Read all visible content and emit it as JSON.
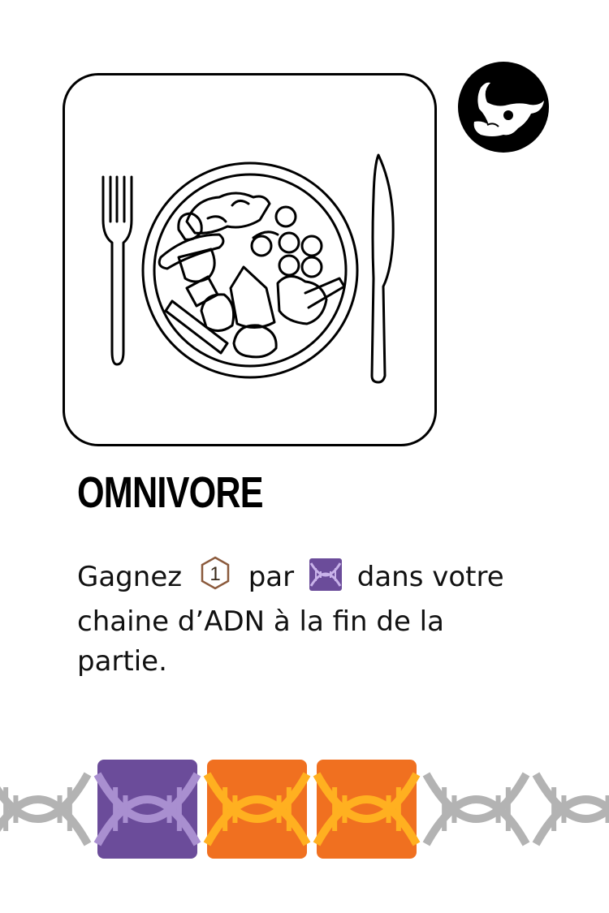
{
  "card": {
    "title": "OMNIVORE",
    "description": {
      "part1": "Gagnez",
      "part2": "par",
      "part3": "dans votre",
      "line2": "chaine d’ADN à la fin de la",
      "line3": "partie."
    },
    "reward_value": "1",
    "reward_icon": "hexagon-point-icon",
    "dna_icon": "purple-dna-icon",
    "badge_icon": "bull-skull-icon",
    "illustration": "plate-fork-knife-icon"
  },
  "dna_chain": [
    {
      "kind": "gray",
      "color": "#b3b3b3"
    },
    {
      "kind": "purple",
      "color": "#6b4c9a"
    },
    {
      "kind": "orange",
      "color": "#f07020"
    },
    {
      "kind": "orange",
      "color": "#f07020"
    },
    {
      "kind": "gray",
      "color": "#b3b3b3"
    },
    {
      "kind": "gray",
      "color": "#b3b3b3"
    }
  ],
  "colors": {
    "purple": "#6b4c9a",
    "purple_light": "#a98fd0",
    "orange": "#f07020",
    "orange_light": "#ffb020",
    "gray": "#b3b3b3",
    "reward": "#8b5a3c"
  }
}
